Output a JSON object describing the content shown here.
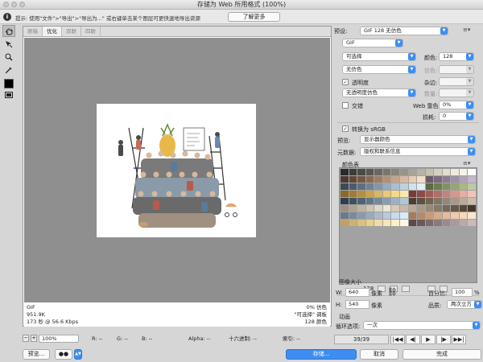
{
  "window": {
    "title": "存储为 Web 所用格式 (100%)"
  },
  "infobar": {
    "icon": "info-icon",
    "text": "提示: 使用\"文件\">\"导出\">\"导出为...\" 或右键单击某个图层可更快速地导出资源",
    "learn_more": "了解更多"
  },
  "tools": [
    "hand-icon",
    "slice-select-icon",
    "zoom-icon",
    "eyedropper-icon"
  ],
  "tabs": [
    {
      "label": "原稿",
      "active": false
    },
    {
      "label": "优化",
      "active": true
    },
    {
      "label": "双联",
      "active": false
    },
    {
      "label": "四联",
      "active": false
    }
  ],
  "status": {
    "format": "GIF",
    "size": "951.9K",
    "time": "173 秒 @ 56.6 Kbps",
    "dither": "0% 仿色",
    "palette": "\"可选择\" 调板",
    "colors": "128 颜色"
  },
  "bottombar": {
    "zoom": "100%",
    "r": "R: --",
    "g": "G: --",
    "b": "B: --",
    "alpha": "Alpha: --",
    "hex": "十六进制: --",
    "index": "索引: --"
  },
  "buttons": {
    "preview": "预览...",
    "save": "存储...",
    "cancel": "取消",
    "done": "完成"
  },
  "settings": {
    "preset_label": "预设:",
    "preset_value": "GIF 128 无仿色",
    "format_value": "GIF",
    "reduction_value": "可选择",
    "colors_label": "颜色:",
    "colors_value": "128",
    "dither_algo": "无仿色",
    "dither_label": "仿色:",
    "transparency_label": "透明度",
    "matte_label": "杂边:",
    "transp_dither": "无透明度仿色",
    "amount_label": "数量:",
    "interlaced_label": "交错",
    "web_snap_label": "Web 靠色:",
    "web_snap_value": "0%",
    "lossy_label": "损耗:",
    "lossy_value": "0",
    "srgb_label": "转换为 sRGB",
    "preview_label": "预览:",
    "preview_value": "显示器颜色",
    "metadata_label": "元数据:",
    "metadata_value": "版权和联系信息",
    "color_table_label": "颜色表",
    "color_count": "128",
    "image_size_label": "图像大小",
    "w_label": "W:",
    "w_value": "640",
    "h_label": "H:",
    "h_value": "540",
    "unit": "像素",
    "percent_label": "百分比:",
    "percent_value": "100",
    "percent_unit": "%",
    "quality_label": "品质:",
    "quality_value": "两次立方（较平滑）",
    "animation_label": "动画",
    "loop_label": "循环选项:",
    "loop_value": "一次",
    "frame_counter": "39/39"
  },
  "palette_colors": [
    "#2a2a2a",
    "#3c3c3c",
    "#4d4a46",
    "#5a5550",
    "#6b665f",
    "#7a756c",
    "#8a847a",
    "#9a9488",
    "#a9a394",
    "#b8b2a2",
    "#c7c1b0",
    "#d5d0be",
    "#e2ddcc",
    "#eeeadb",
    "#f6f3e8",
    "#ffffff",
    "#4a3a30",
    "#5e4838",
    "#735744",
    "#876a54",
    "#9c7d64",
    "#b09076",
    "#c3a488",
    "#d6b99c",
    "#e6cdb0",
    "#f2dfc6",
    "#6a5a6a",
    "#7c6a7e",
    "#8e7c92",
    "#a090a6",
    "#b2a4b8",
    "#c4b8ca",
    "#3a4a5a",
    "#4a5c6e",
    "#5c7082",
    "#6e8496",
    "#8098aa",
    "#94acbe",
    "#a8c0d0",
    "#bcd2e0",
    "#cfe2ee",
    "#e0eef6",
    "#5a6a3a",
    "#6e7e4a",
    "#82925c",
    "#96a66e",
    "#aab882",
    "#becaa0",
    "#8a6a2a",
    "#a07c34",
    "#b68e40",
    "#caa24e",
    "#dcb660",
    "#eac874",
    "#f4d88a",
    "#fae8a6",
    "#7a3a3a",
    "#8e4a48",
    "#a25c58",
    "#b46e6a",
    "#c6827c",
    "#d6988e",
    "#e4aea4",
    "#f0c4bc",
    "#2e3e4e",
    "#3e5060",
    "#506274",
    "#627688",
    "#748a9c",
    "#889eb0",
    "#9cb2c2",
    "#b0c6d4",
    "#4e3e2e",
    "#60503e",
    "#726250",
    "#847462",
    "#968674",
    "#a89886",
    "#baaa98",
    "#ccbcaa",
    "#9e8e7e",
    "#aea08e",
    "#beb2a0",
    "#cec4b2",
    "#ded6c6",
    "#ece6d8",
    "#d8c8b8",
    "#c8b8a8",
    "#b8a898",
    "#a89888",
    "#988878",
    "#887868",
    "#786858",
    "#685848",
    "#584838",
    "#483828",
    "#6a7a8a",
    "#7a8a9a",
    "#8a9aaa",
    "#9aaaba",
    "#aabaca",
    "#bacada",
    "#cadaea",
    "#daeaf8",
    "#a87a5a",
    "#b88a6a",
    "#c89a7a",
    "#d8aa8a",
    "#e8ba9a",
    "#f0caaa",
    "#f6d8ba",
    "#fae6ce",
    "#c4a060",
    "#d0b070",
    "#dcc080",
    "#e8d090",
    "#f0dca4",
    "#f6e6b8",
    "#faf0cc",
    "#fdf8e2",
    "#5a4a4a",
    "#6a5a5a",
    "#7a6a6a",
    "#8a7a7a",
    "#9a8a8a",
    "#aa9a9a",
    "#baaaaa",
    "#cababa"
  ]
}
